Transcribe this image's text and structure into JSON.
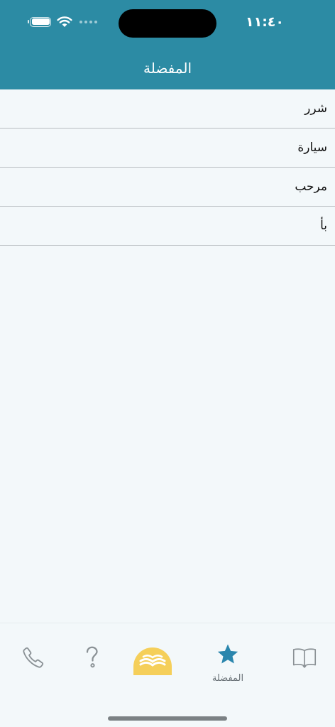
{
  "status_bar": {
    "time": "١١:٤٠"
  },
  "header": {
    "title": "المفضلة"
  },
  "favorites": {
    "items": [
      {
        "label": "شرر"
      },
      {
        "label": "سيارة"
      },
      {
        "label": "مرحب"
      },
      {
        "label": "بأ"
      }
    ]
  },
  "tabbar": {
    "tabs": [
      {
        "icon": "phone-icon",
        "label": ""
      },
      {
        "icon": "question-icon",
        "label": ""
      },
      {
        "icon": "open-book-dome-icon",
        "label": ""
      },
      {
        "icon": "star-icon",
        "label": "المفضلة",
        "selected": true
      },
      {
        "icon": "book-icon",
        "label": ""
      }
    ]
  },
  "colors": {
    "header_bg": "#2c8ba4",
    "background": "#f3f8fa",
    "accent_star": "#2a86ad",
    "center_tab": "#f5cf5a"
  }
}
